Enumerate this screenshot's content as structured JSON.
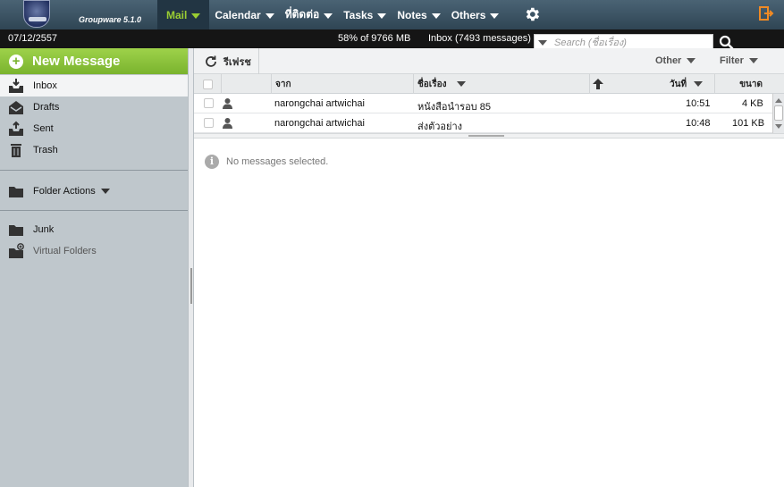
{
  "app": {
    "name": "Groupware 5.1.0"
  },
  "nav": {
    "items": [
      {
        "label": "Mail"
      },
      {
        "label": "Calendar"
      },
      {
        "label": "ที่ติดต่อ"
      },
      {
        "label": "Tasks"
      },
      {
        "label": "Notes"
      },
      {
        "label": "Others"
      }
    ],
    "active_index": 0,
    "icons": {
      "settings": "gear-icon",
      "logout": "logout-icon"
    },
    "colors": {
      "active": "#9acd32",
      "logout": "#f08a24"
    }
  },
  "status": {
    "date": "07/12/2557",
    "quota": "58% of 9766 MB",
    "inbox": "Inbox (7493 messages)"
  },
  "search": {
    "placeholder": "Search (ชื่อเรื่อง)",
    "value": ""
  },
  "sidebar": {
    "new_message": "New Message",
    "new_message_color": "#8cc63f",
    "folders": [
      {
        "label": "Inbox",
        "icon": "inbox-icon",
        "selected": true
      },
      {
        "label": "Drafts",
        "icon": "drafts-icon"
      },
      {
        "label": "Sent",
        "icon": "sent-icon"
      },
      {
        "label": "Trash",
        "icon": "trash-icon"
      }
    ],
    "folder_actions": "Folder Actions",
    "extra": [
      {
        "label": "Junk",
        "icon": "folder-icon"
      },
      {
        "label": "Virtual Folders",
        "icon": "virtual-folder-icon"
      }
    ]
  },
  "toolbar": {
    "refresh": "รีเฟรช",
    "other": "Other",
    "filter": "Filter"
  },
  "list": {
    "columns": {
      "from": "จาก",
      "subject": "ชื่อเรื่อง",
      "date": "วันที่",
      "size": "ขนาด"
    },
    "rows": [
      {
        "from": "narongchai artwichai",
        "subject": "หนังสือนำรอบ 85",
        "time": "10:51",
        "size": "4 KB"
      },
      {
        "from": "narongchai artwichai",
        "subject": "ส่งตัวอย่าง",
        "time": "10:48",
        "size": "101 KB"
      }
    ]
  },
  "preview": {
    "empty_text": "No messages selected."
  }
}
